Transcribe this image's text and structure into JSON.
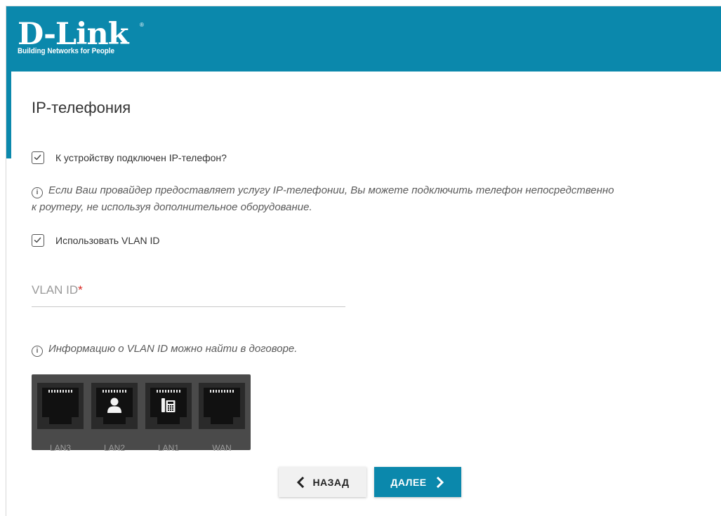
{
  "brand": {
    "logo_text": "D-Link",
    "registered_mark": "®",
    "tagline": "Building Networks for People"
  },
  "page": {
    "title": "IP-телефония"
  },
  "options": {
    "ip_phone_connected_label": "К устройству подключен IP-телефон?",
    "ip_phone_connected_checked": true,
    "use_vlan_label": "Использовать VLAN ID",
    "use_vlan_checked": true
  },
  "info": {
    "provider_line1": "Если Ваш провайдер предоставляет услугу IP-телефонии, Вы можете подключить телефон непосредственно",
    "provider_line2": "к роутеру, не используя дополнительное оборудование.",
    "vlan_hint": "Информацию о VLAN ID можно найти в договоре."
  },
  "vlan_field": {
    "label": "VLAN ID",
    "required_mark": "*",
    "value": ""
  },
  "ports": [
    {
      "label": "LAN3",
      "icon": "none"
    },
    {
      "label": "LAN2",
      "icon": "user-icon"
    },
    {
      "label": "LAN1",
      "icon": "phone-icon"
    },
    {
      "label": "WAN",
      "icon": "none"
    }
  ],
  "buttons": {
    "back_label": "НАЗАД",
    "next_label": "ДАЛЕЕ"
  },
  "colors": {
    "brand_blue": "#0b88ac",
    "required_red": "#d9241e",
    "ports_bg": "#4a4a4a"
  }
}
